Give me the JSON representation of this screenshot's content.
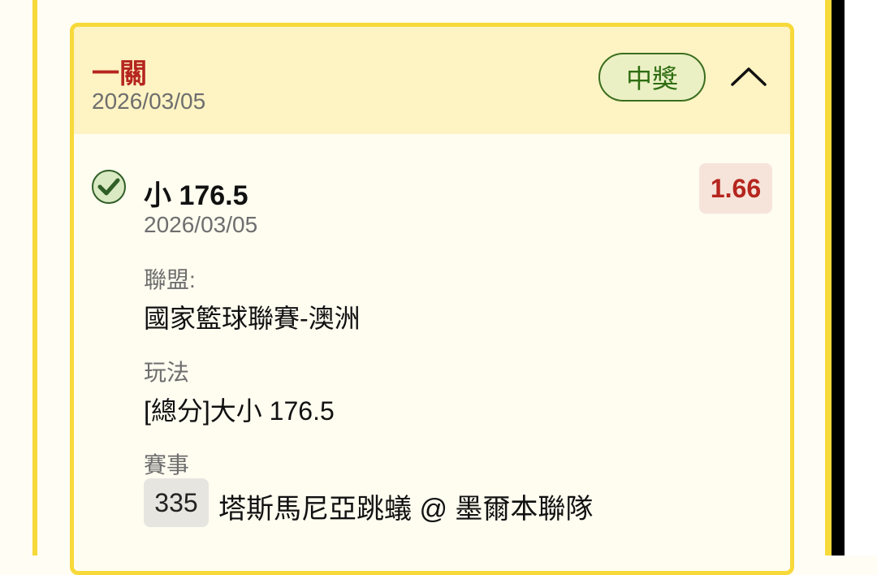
{
  "bet": {
    "type_label": "一關",
    "date": "2026/03/05",
    "result_label": "中獎",
    "collapse_icon": "chevron-up-icon"
  },
  "selection": {
    "status_icon": "check-circle-icon",
    "name": "小 176.5",
    "date": "2026/03/05",
    "odds": "1.66",
    "league_label": "聯盟:",
    "league_value": "國家籃球聯賽-澳洲",
    "market_label": "玩法",
    "market_value": "[總分]大小 176.5",
    "match_label": "賽事",
    "match_number": "335",
    "match_name": "塔斯馬尼亞跳蟻 @ 墨爾本聯隊"
  },
  "colors": {
    "card_border": "#f7d93a",
    "header_bg": "#fdf3c3",
    "bet_type_red": "#b5261e",
    "win_green": "#2f6d12"
  }
}
